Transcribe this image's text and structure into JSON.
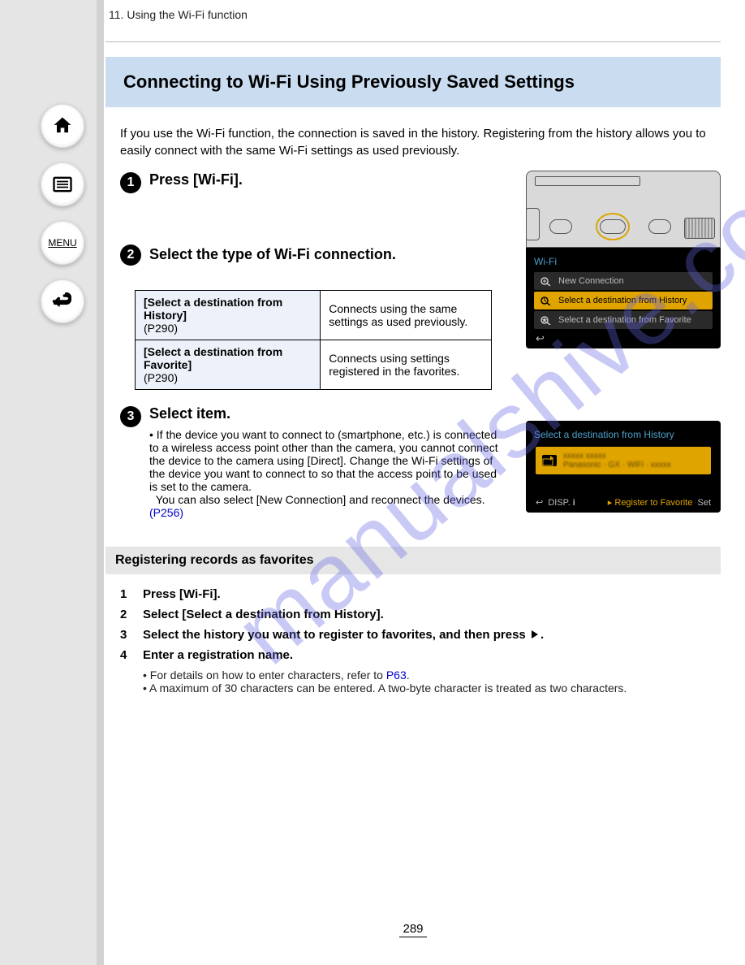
{
  "breadcrumb_section": "11.",
  "breadcrumb_text": "Using the Wi-Fi function",
  "title": "Connecting to Wi-Fi Using Previously Saved Settings",
  "intro": "If you use the Wi-Fi function, the connection is saved in the history. Registering from the history allows you to easily connect with the same Wi-Fi settings as used previously.",
  "step1": "Press [Wi-Fi].",
  "step2": "Select the type of Wi-Fi connection.",
  "table": {
    "r1_label": "[Select a destination from History]",
    "r1_desc": "Connects using the same settings as used previously.",
    "r2_label": "[Select a destination from Favorite]",
    "r2_desc": "Connects using settings registered in the favorites.",
    "sub_r1": "(P290)",
    "sub_r2": "(P290)"
  },
  "step3": "Select item.",
  "step3_bullet": "If the device you want to connect to (smartphone, etc.) is connected to a wireless access point other than the camera, you cannot connect the device to the camera using [Direct]. Change the Wi-Fi settings of the device you want to connect to so that the access point to be used is set to the camera.",
  "step3_bullet2_pre": "You can also select [New Connection] and reconnect the devices.",
  "step3_bullet2_link": "(P256)",
  "lcd1": {
    "header": "Wi-Fi",
    "row_new": "New Connection",
    "row_hist": "Select a destination from History",
    "row_fav": "Select a destination from Favorite"
  },
  "lcd2": {
    "header": "Select a destination from History",
    "blur1": "xxxxx xxxxx",
    "blur2": "Panasonic · GX · WiFi · xxxxx",
    "foot_disp": "DISP.",
    "foot_i": "i",
    "foot_reg": "Register to Favorite",
    "foot_set": "Set"
  },
  "subheading": "Registering records as favorites",
  "sub1": "Press [Wi-Fi].",
  "sub2": "Select [Select a destination from History].",
  "sub3_pre": "Select the history you want to register to favorites, and then press ",
  "sub3_post": ".",
  "sub4": "Enter a registration name.",
  "sub4_b1_pre": "For details on how to enter characters, refer to ",
  "sub4_b1_link": "P63",
  "sub4_b1_post": ".",
  "sub4_b2": "A maximum of 30 characters can be entered. A two-byte character is treated as two characters.",
  "page_number": "289",
  "nav": {
    "menu": "MENU"
  },
  "watermark": "manualshive.com"
}
